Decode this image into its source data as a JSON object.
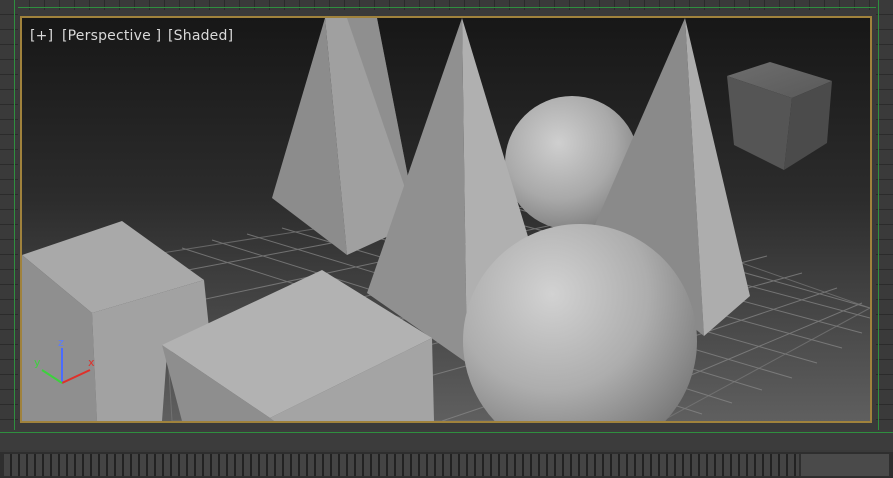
{
  "viewport": {
    "labels": {
      "plus": "[+]",
      "view": "[Perspective ]",
      "shading": "[Shaded]"
    },
    "axes": {
      "x": "x",
      "y": "y",
      "z": "z"
    }
  },
  "colors": {
    "viewport_border": "#a0823c",
    "rail_line": "#2f8f3f",
    "axis_x": "#e0302a",
    "axis_y": "#3cd23c",
    "axis_z": "#4a6cff"
  },
  "icons": {
    "view_cube": "view-cube-icon",
    "axis_tripod": "axis-tripod-icon"
  }
}
